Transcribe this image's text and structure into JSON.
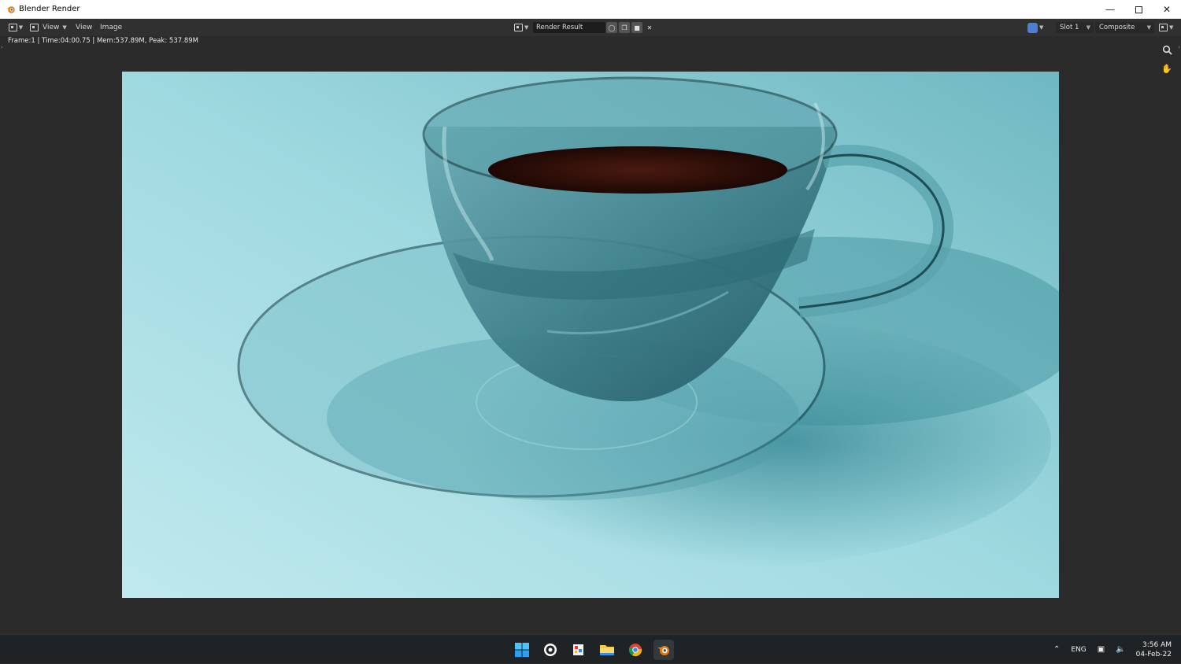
{
  "window": {
    "title": "Blender Render",
    "controls": [
      "minimize-icon",
      "maximize-icon",
      "close-icon"
    ]
  },
  "header": {
    "editor_type_icon": "image-editor-icon",
    "view_mode": "View",
    "menus": [
      "View",
      "Image"
    ],
    "image_name": "Render Result",
    "image_buttons": [
      "fake-user-icon",
      "duplicate-icon",
      "open-folder-icon",
      "close-icon"
    ],
    "slot": "Slot 1",
    "layer": "Composite"
  },
  "stats_text": "Frame:1 | Time:04:00.75 | Mem:537.89M, Peak: 537.89M",
  "side_tools": [
    "zoom-icon",
    "hand-pan-icon"
  ],
  "taskbar": {
    "apps": [
      "windows-start-icon",
      "obs-icon",
      "paint-icon",
      "file-explorer-icon",
      "chrome-icon",
      "blender-icon"
    ],
    "active_app": "blender-icon",
    "language": "ENG",
    "time": "3:56 AM",
    "date": "04-Feb-22"
  },
  "colors": {
    "background_teal": "#8fd0d8",
    "ui_dark": "#303030",
    "blender_orange": "#e87d0d"
  }
}
